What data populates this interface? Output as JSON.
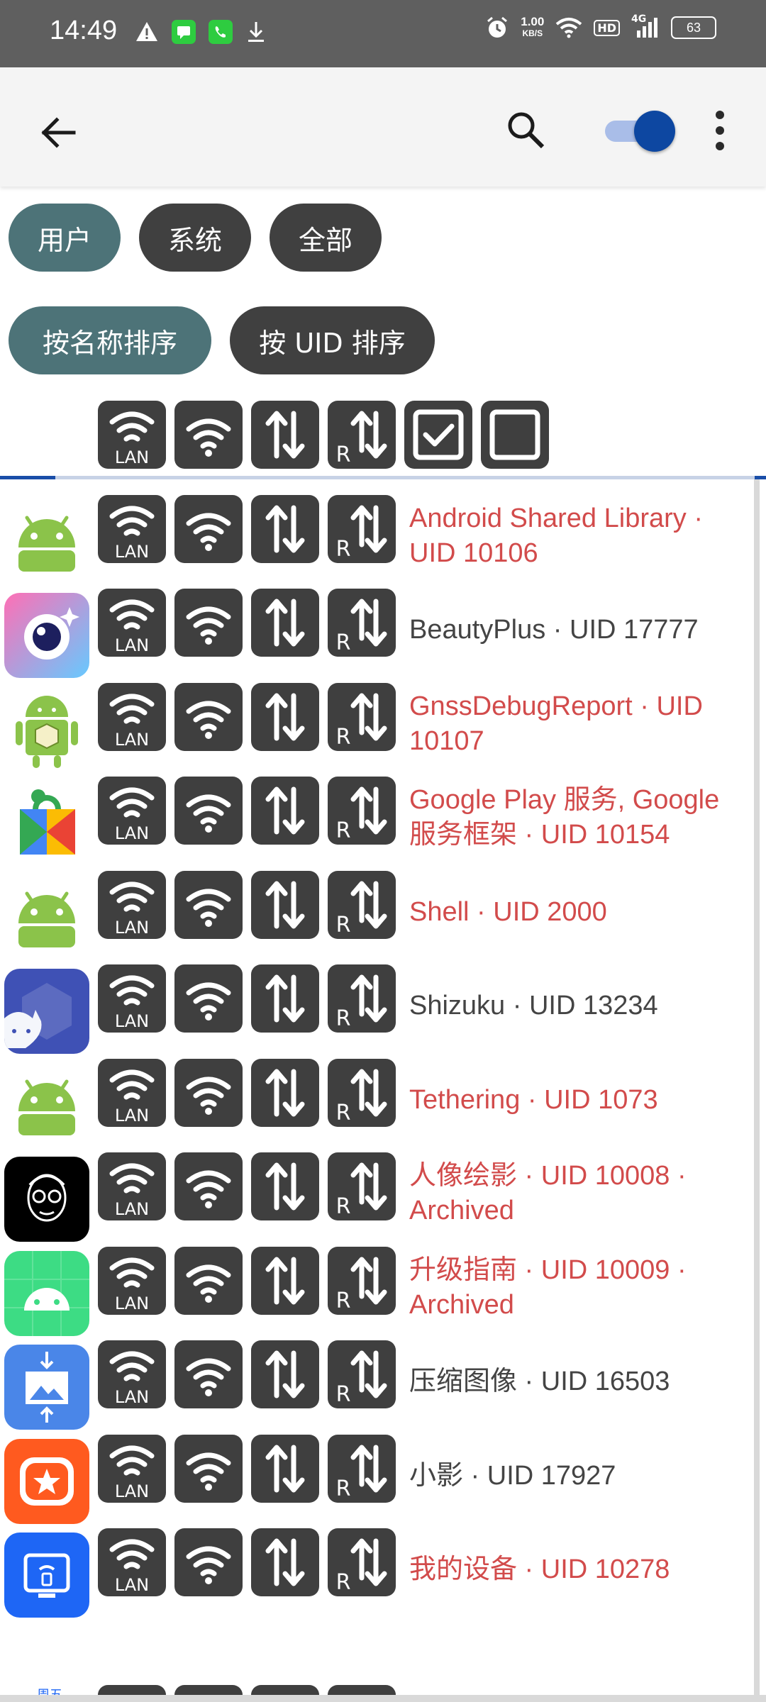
{
  "status_bar": {
    "time": "14:49",
    "net_speed_value": "1.00",
    "net_speed_unit": "KB/S",
    "hd_label": "HD",
    "signal_label": "4G",
    "battery": "63"
  },
  "app_bar": {
    "back_icon": "arrow-left-icon",
    "search_icon": "search-icon",
    "toggle_on": true,
    "more_icon": "more-vert-icon"
  },
  "filters": {
    "type_chips": [
      {
        "label": "用户",
        "active": true
      },
      {
        "label": "系统",
        "active": false
      },
      {
        "label": "全部",
        "active": false
      }
    ],
    "sort_chips": [
      {
        "label": "按名称排序",
        "active": true
      },
      {
        "label": "按 UID 排序",
        "active": false
      }
    ]
  },
  "header_controls": [
    "wifi-lan-icon",
    "wifi-icon",
    "mobile-data-icon",
    "roaming-data-icon",
    "check-all-icon",
    "uncheck-all-icon"
  ],
  "tile_text": {
    "lan": "LAN",
    "roaming": "R"
  },
  "colors": {
    "system_app": "#d24b4b",
    "user_app": "#444444",
    "chip_active": "#4d7378",
    "chip_inactive": "#404040",
    "tile": "#3f3f3f",
    "accent": "#0d47a1"
  },
  "apps": [
    {
      "name": "Android Shared Library · UID 10106",
      "system": true,
      "icon": "android-robot-icon"
    },
    {
      "name": "BeautyPlus · UID 17777",
      "system": false,
      "icon": "beautyplus-icon"
    },
    {
      "name": "GnssDebugReport · UID 10107",
      "system": true,
      "icon": "android-cube-icon"
    },
    {
      "name": "Google Play 服务, Google 服务框架 · UID 10154",
      "system": true,
      "icon": "play-services-icon"
    },
    {
      "name": "Shell · UID 2000",
      "system": true,
      "icon": "android-robot-icon"
    },
    {
      "name": "Shizuku · UID 13234",
      "system": false,
      "icon": "shizuku-icon"
    },
    {
      "name": "Tethering · UID 1073",
      "system": true,
      "icon": "android-robot-icon"
    },
    {
      "name": "人像绘影 · UID 10008 · Archived",
      "system": true,
      "icon": "portrait-sketch-icon"
    },
    {
      "name": "升级指南 · UID 10009 · Archived",
      "system": true,
      "icon": "android-green-icon"
    },
    {
      "name": "压缩图像 · UID 16503",
      "system": false,
      "icon": "compress-image-icon"
    },
    {
      "name": "小影 · UID 17927",
      "system": false,
      "icon": "xiaoying-icon"
    },
    {
      "name": "我的设备 · UID 10278",
      "system": true,
      "icon": "my-device-icon"
    }
  ],
  "partial_row_icon_text": "周五"
}
